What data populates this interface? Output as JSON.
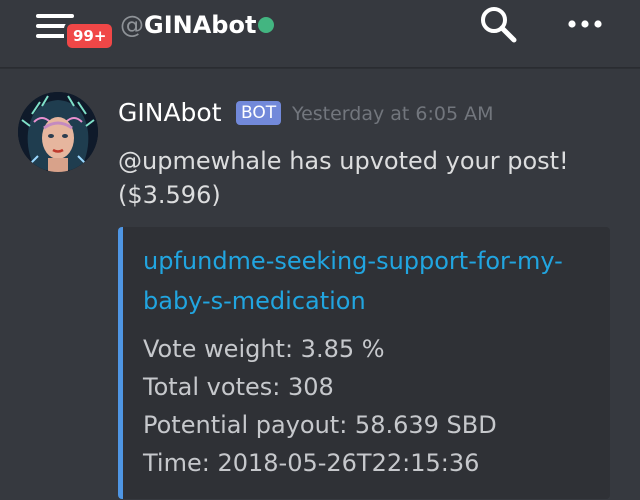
{
  "header": {
    "unread_badge": "99+",
    "channel_prefix": "@",
    "channel_name": "GINAbot",
    "status_color": "#43b581",
    "menu_icon": "hamburger-menu-icon",
    "search_icon": "search-icon",
    "more_icon": "more-dots-icon"
  },
  "message": {
    "author": "GINAbot",
    "bot_tag": "BOT",
    "timestamp": "Yesterday at 6:05 AM",
    "text": "@upmewhale has upvoted your post! ($3.596)",
    "embed": {
      "accent_color": "#4f96e4",
      "title": "upfundme-seeking-support-for-my-baby-s-medication",
      "fields": [
        "Vote weight: 3.85 %",
        "Total votes: 308",
        "Potential payout: 58.639 SBD",
        "Time: 2018-05-26T22:15:36"
      ]
    }
  }
}
